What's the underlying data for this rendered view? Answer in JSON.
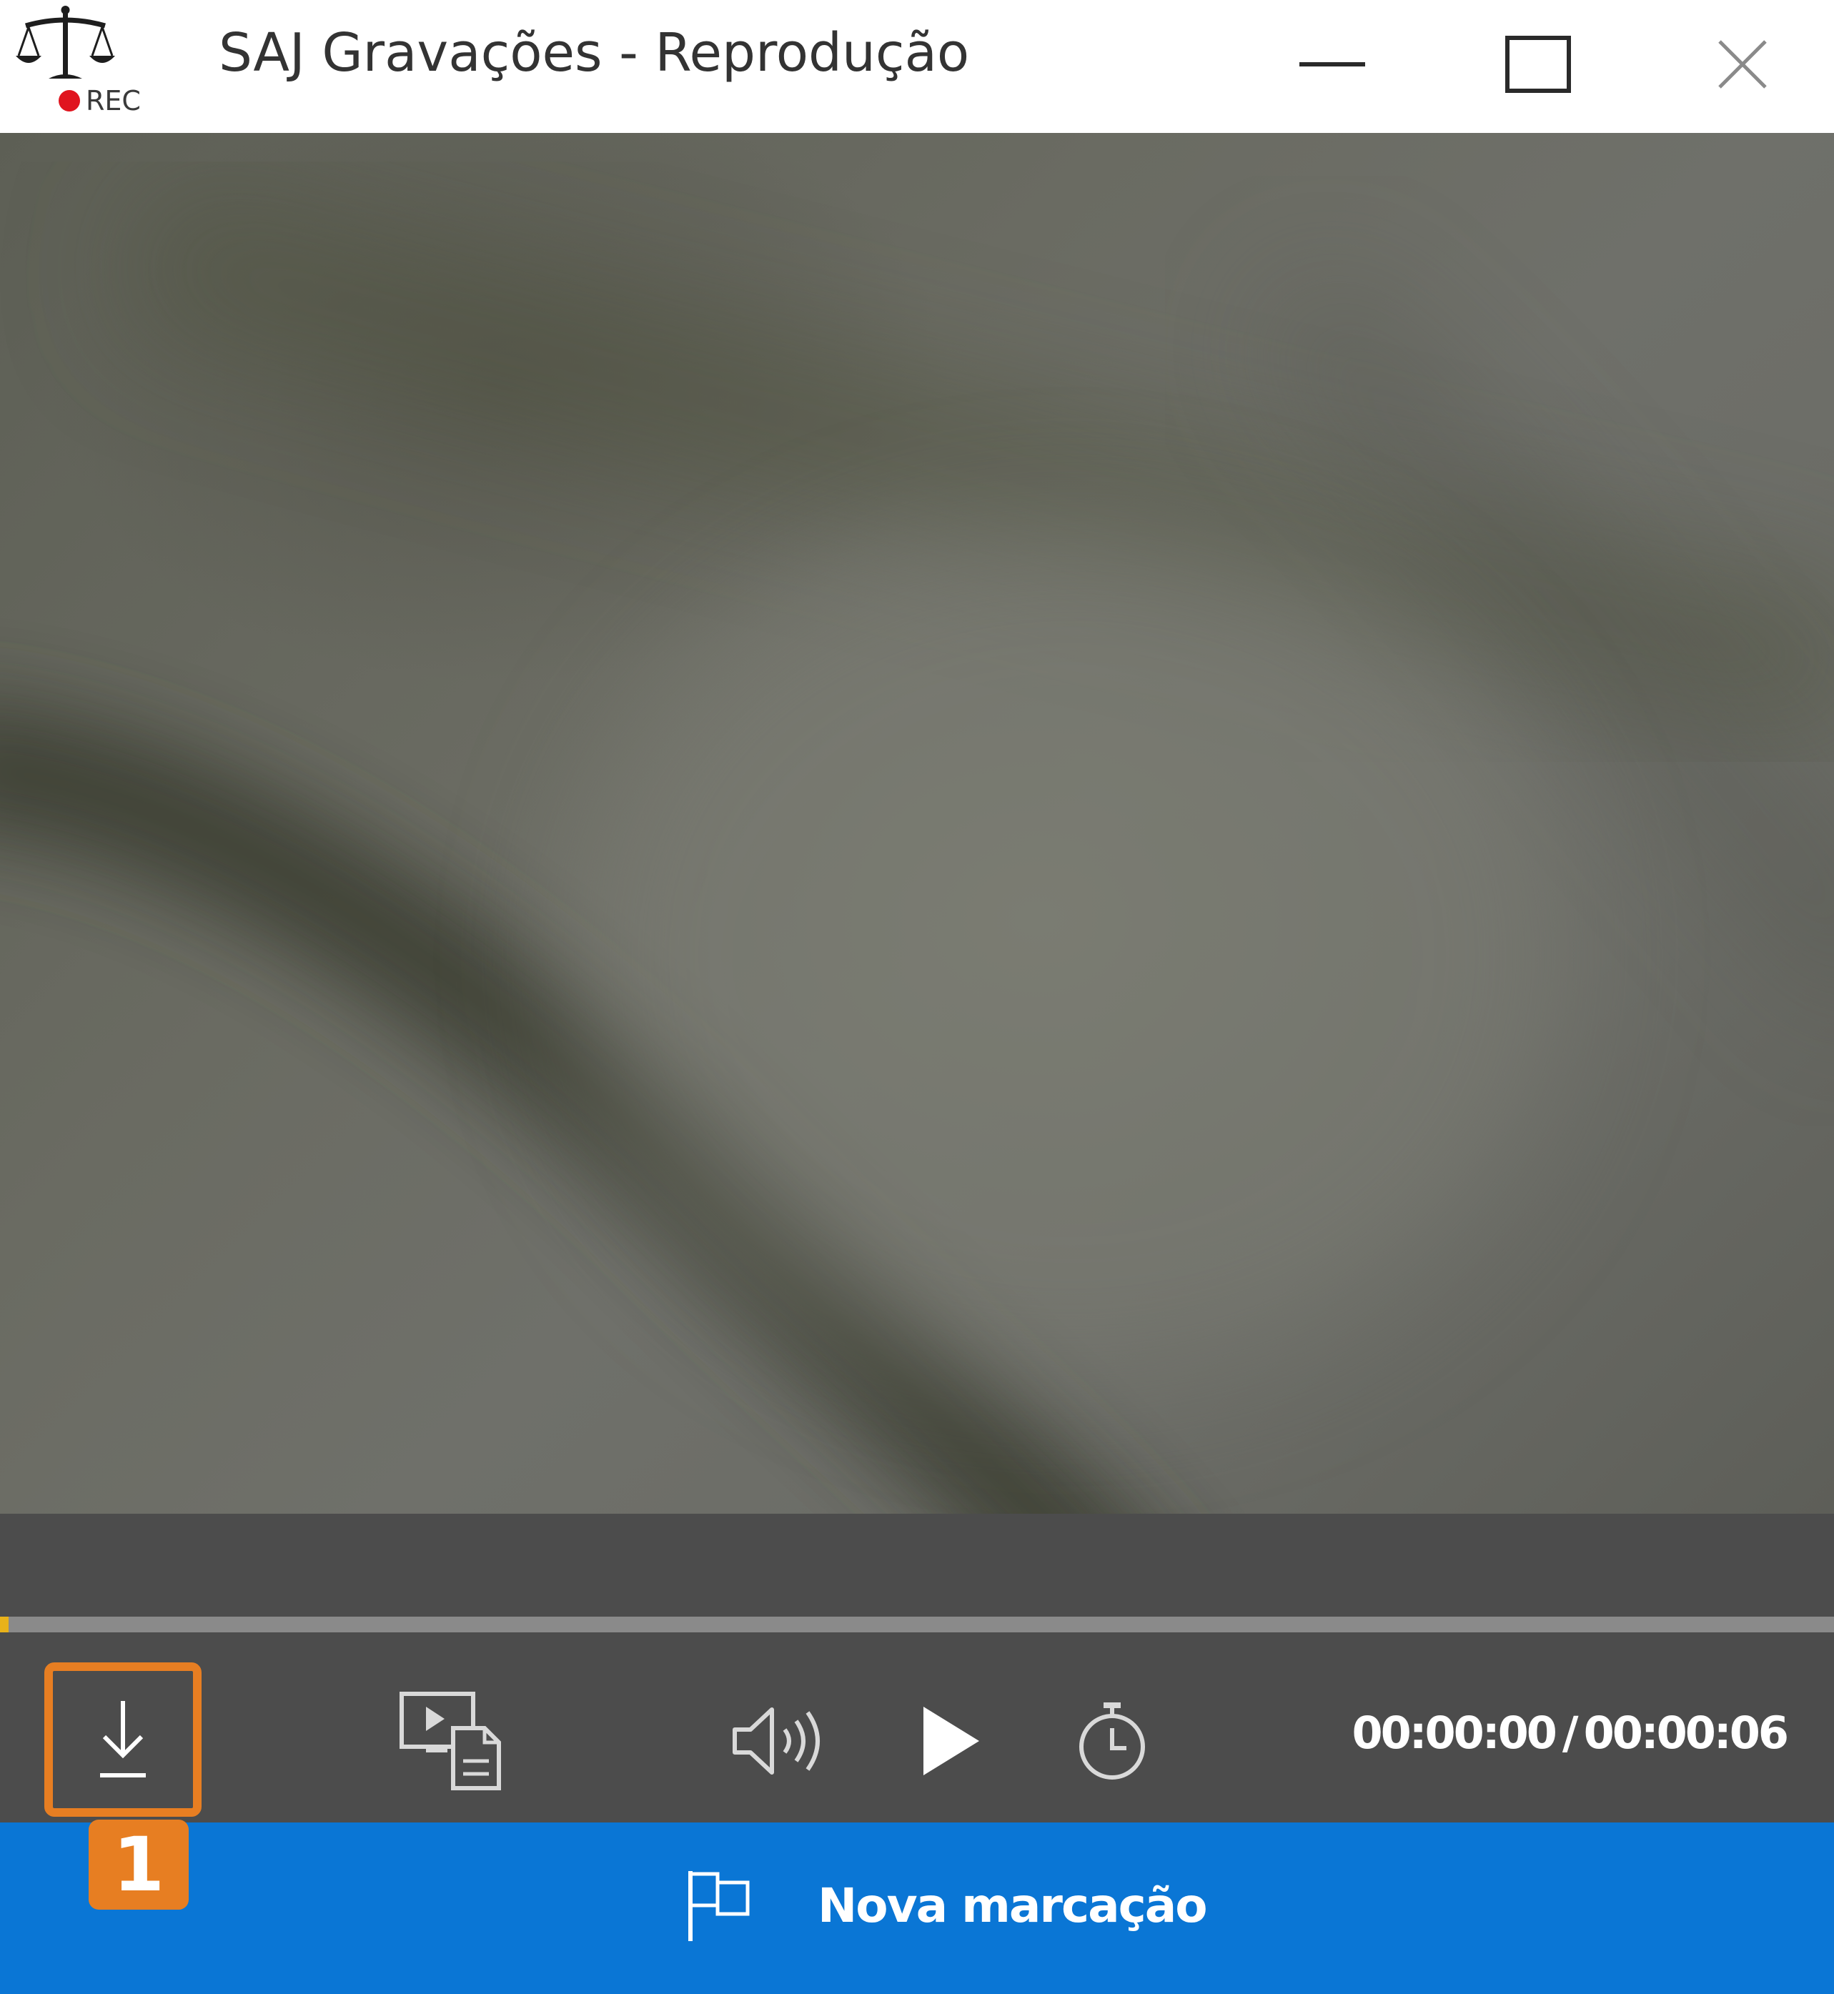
{
  "window": {
    "title": "SAJ Gravações - Reprodução",
    "logo_badge": "REC"
  },
  "player": {
    "current_time": "00:00:00",
    "separator": "/",
    "total_time": "00:00:06",
    "progress_fraction": 0.004
  },
  "action_bar": {
    "label": "Nova marcação"
  },
  "callout": {
    "step": "1"
  },
  "colors": {
    "accent_blue": "#0a76d5",
    "callout_orange": "#e77e22",
    "control_bg": "#4c4c4c",
    "progress_fill": "#e8b21a",
    "rec_red": "#e0141e"
  },
  "icons": {
    "logo": "scales-of-justice-icon",
    "minimize": "minimize-icon",
    "maximize": "maximize-icon",
    "close": "close-icon",
    "download": "download-icon",
    "export": "video-document-icon",
    "volume": "volume-icon",
    "play": "play-icon",
    "timer": "stopwatch-icon",
    "flag": "flag-icon"
  }
}
